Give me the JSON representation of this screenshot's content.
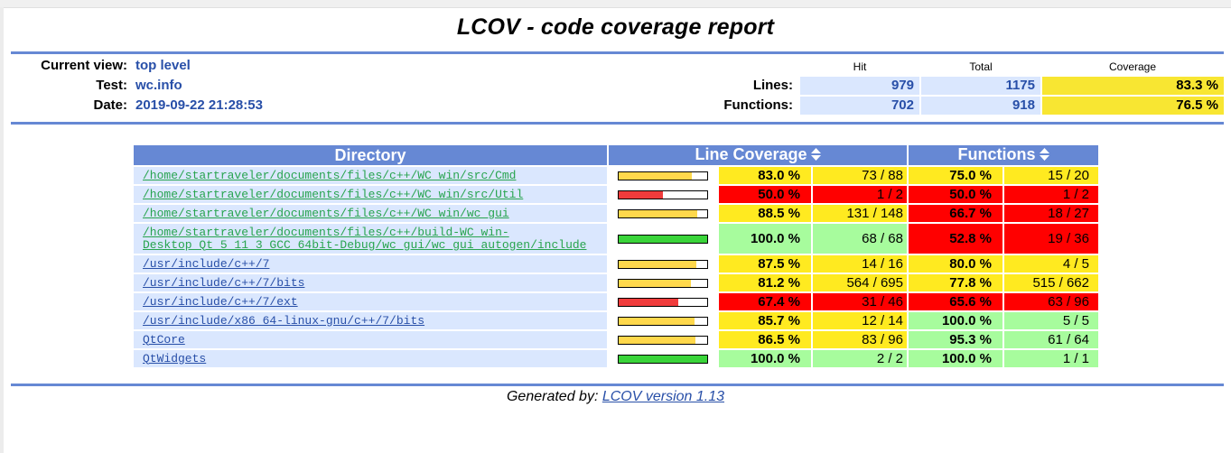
{
  "title": "LCOV - code coverage report",
  "header": {
    "current_view_label": "Current view:",
    "current_view": "top level",
    "test_label": "Test:",
    "test": "wc.info",
    "date_label": "Date:",
    "date": "2019-09-22 21:28:53"
  },
  "summary": {
    "col_hit": "Hit",
    "col_total": "Total",
    "col_coverage": "Coverage",
    "lines_label": "Lines:",
    "lines_hit": "979",
    "lines_total": "1175",
    "lines_coverage": "83.3 %",
    "functions_label": "Functions:",
    "functions_hit": "702",
    "functions_total": "918",
    "functions_coverage": "76.5 %"
  },
  "table": {
    "col_directory": "Directory",
    "col_line_coverage": "Line Coverage",
    "col_functions": "Functions",
    "rows": [
      {
        "dir": "/home/startraveler/documents/files/c++/WC_win/src/Cmd",
        "link_color": "green",
        "line_pct": "83.0 %",
        "line_frac": 0.83,
        "line_level": "med",
        "line_cnt": "73 / 88",
        "func_pct": "75.0 %",
        "func_level": "med",
        "func_cnt": "15 / 20"
      },
      {
        "dir": "/home/startraveler/documents/files/c++/WC_win/src/Util",
        "link_color": "green",
        "line_pct": "50.0 %",
        "line_frac": 0.5,
        "line_level": "lo",
        "line_cnt": "1 / 2",
        "func_pct": "50.0 %",
        "func_level": "lo",
        "func_cnt": "1 / 2"
      },
      {
        "dir": "/home/startraveler/documents/files/c++/WC_win/wc_gui",
        "link_color": "green",
        "line_pct": "88.5 %",
        "line_frac": 0.885,
        "line_level": "med",
        "line_cnt": "131 / 148",
        "func_pct": "66.7 %",
        "func_level": "lo",
        "func_cnt": "18 / 27"
      },
      {
        "dir": "/home/startraveler/documents/files/c++/build-WC_win-Desktop_Qt_5_11_3_GCC_64bit-Debug/wc_gui/wc_gui_autogen/include",
        "link_color": "green",
        "line_pct": "100.0 %",
        "line_frac": 1.0,
        "line_level": "hi",
        "line_cnt": "68 / 68",
        "func_pct": "52.8 %",
        "func_level": "lo",
        "func_cnt": "19 / 36"
      },
      {
        "dir": "/usr/include/c++/7",
        "link_color": "blue",
        "line_pct": "87.5 %",
        "line_frac": 0.875,
        "line_level": "med",
        "line_cnt": "14 / 16",
        "func_pct": "80.0 %",
        "func_level": "med",
        "func_cnt": "4 / 5"
      },
      {
        "dir": "/usr/include/c++/7/bits",
        "link_color": "blue",
        "line_pct": "81.2 %",
        "line_frac": 0.812,
        "line_level": "med",
        "line_cnt": "564 / 695",
        "func_pct": "77.8 %",
        "func_level": "med",
        "func_cnt": "515 / 662"
      },
      {
        "dir": "/usr/include/c++/7/ext",
        "link_color": "blue",
        "line_pct": "67.4 %",
        "line_frac": 0.674,
        "line_level": "lo",
        "line_cnt": "31 / 46",
        "func_pct": "65.6 %",
        "func_level": "lo",
        "func_cnt": "63 / 96"
      },
      {
        "dir": "/usr/include/x86_64-linux-gnu/c++/7/bits",
        "link_color": "blue",
        "line_pct": "85.7 %",
        "line_frac": 0.857,
        "line_level": "med",
        "line_cnt": "12 / 14",
        "func_pct": "100.0 %",
        "func_level": "hi",
        "func_cnt": "5 / 5"
      },
      {
        "dir": "QtCore",
        "link_color": "blue",
        "line_pct": "86.5 %",
        "line_frac": 0.865,
        "line_level": "med",
        "line_cnt": "83 / 96",
        "func_pct": "95.3 %",
        "func_level": "hi",
        "func_cnt": "61 / 64"
      },
      {
        "dir": "QtWidgets",
        "link_color": "blue",
        "line_pct": "100.0 %",
        "line_frac": 1.0,
        "line_level": "hi",
        "line_cnt": "2 / 2",
        "func_pct": "100.0 %",
        "func_level": "hi",
        "func_cnt": "1 / 1"
      }
    ]
  },
  "footer": {
    "prefix": "Generated by: ",
    "link": "LCOV version 1.13"
  },
  "colors": {
    "header_blue": "#6688d4",
    "hi": "#a7fc9d",
    "med": "#ffea20",
    "lo": "#ff0000",
    "bar_hi": "#3ad43a",
    "bar_med": "#ffd84c",
    "bar_lo": "#f03c3c"
  }
}
